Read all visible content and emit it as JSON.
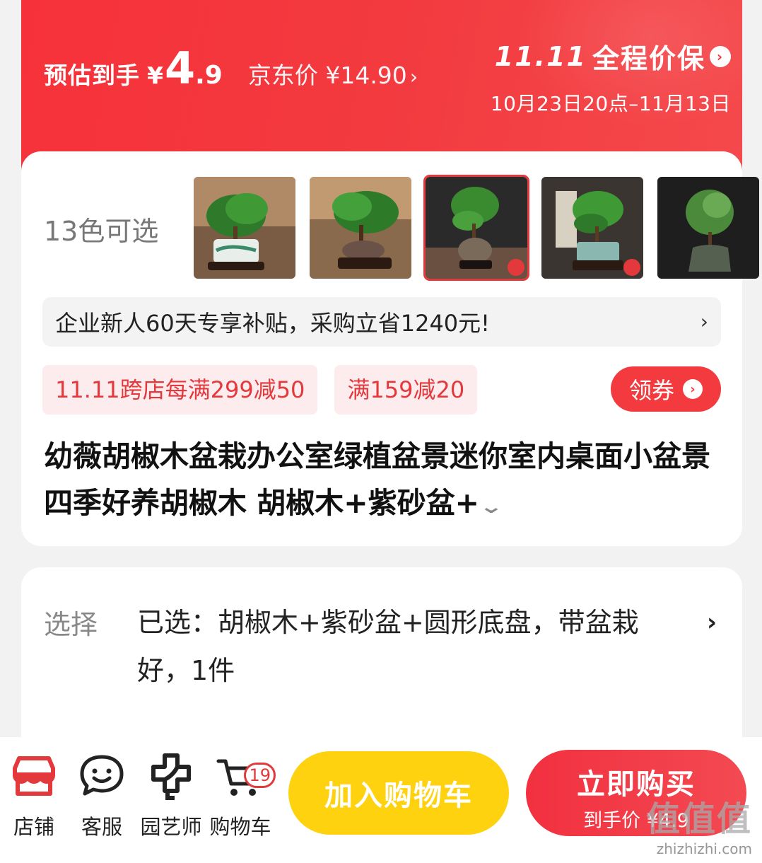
{
  "banner": {
    "price_label": "预估到手",
    "price_yen": "¥",
    "price_int": "4",
    "price_dec": ".9",
    "jd_price": "京东价 ¥14.90",
    "jd_chevron": "›",
    "promo_logo": "11.11",
    "promo_title": "全程价保",
    "promo_dates": "10月23日20点–11月13日"
  },
  "product": {
    "colors_label": "13色可选",
    "thumbnails": [
      {
        "name": "thumb-1"
      },
      {
        "name": "thumb-2"
      },
      {
        "name": "thumb-3",
        "selected": true
      },
      {
        "name": "thumb-4"
      },
      {
        "name": "thumb-5"
      }
    ],
    "subsidy_text": "企业新人60天专享补贴，采购立省1240元!",
    "subsidy_chevron": "›",
    "coupons": [
      "11.11跨店每满299减50",
      "满159减20"
    ],
    "get_coupon_label": "领券",
    "title": "幼薇胡椒木盆栽办公室绿植盆景迷你室内桌面小盆景四季好养胡椒木 胡椒木+紫砂盆+"
  },
  "options": {
    "label": "选择",
    "value": "已选：胡椒木+紫砂盆+圆形底盘，带盆栽好，1件",
    "chevron": "›"
  },
  "bottom_bar": {
    "nav": [
      {
        "label": "店铺",
        "icon": "store-icon"
      },
      {
        "label": "客服",
        "icon": "customer-service-icon"
      },
      {
        "label": "园艺师",
        "icon": "gardener-icon"
      },
      {
        "label": "购物车",
        "icon": "cart-icon",
        "badge": "19"
      }
    ],
    "add_to_cart": "加入购物车",
    "buy_now": "立即购买",
    "buy_now_sub": "到手价 ¥4.9"
  },
  "watermark": {
    "line1": "值值值",
    "line2": "zhizhizhi.com"
  },
  "colors": {
    "accent_red": "#f23a3f",
    "cart_yellow": "#ffd20f",
    "coupon_bg": "#fdecee"
  }
}
